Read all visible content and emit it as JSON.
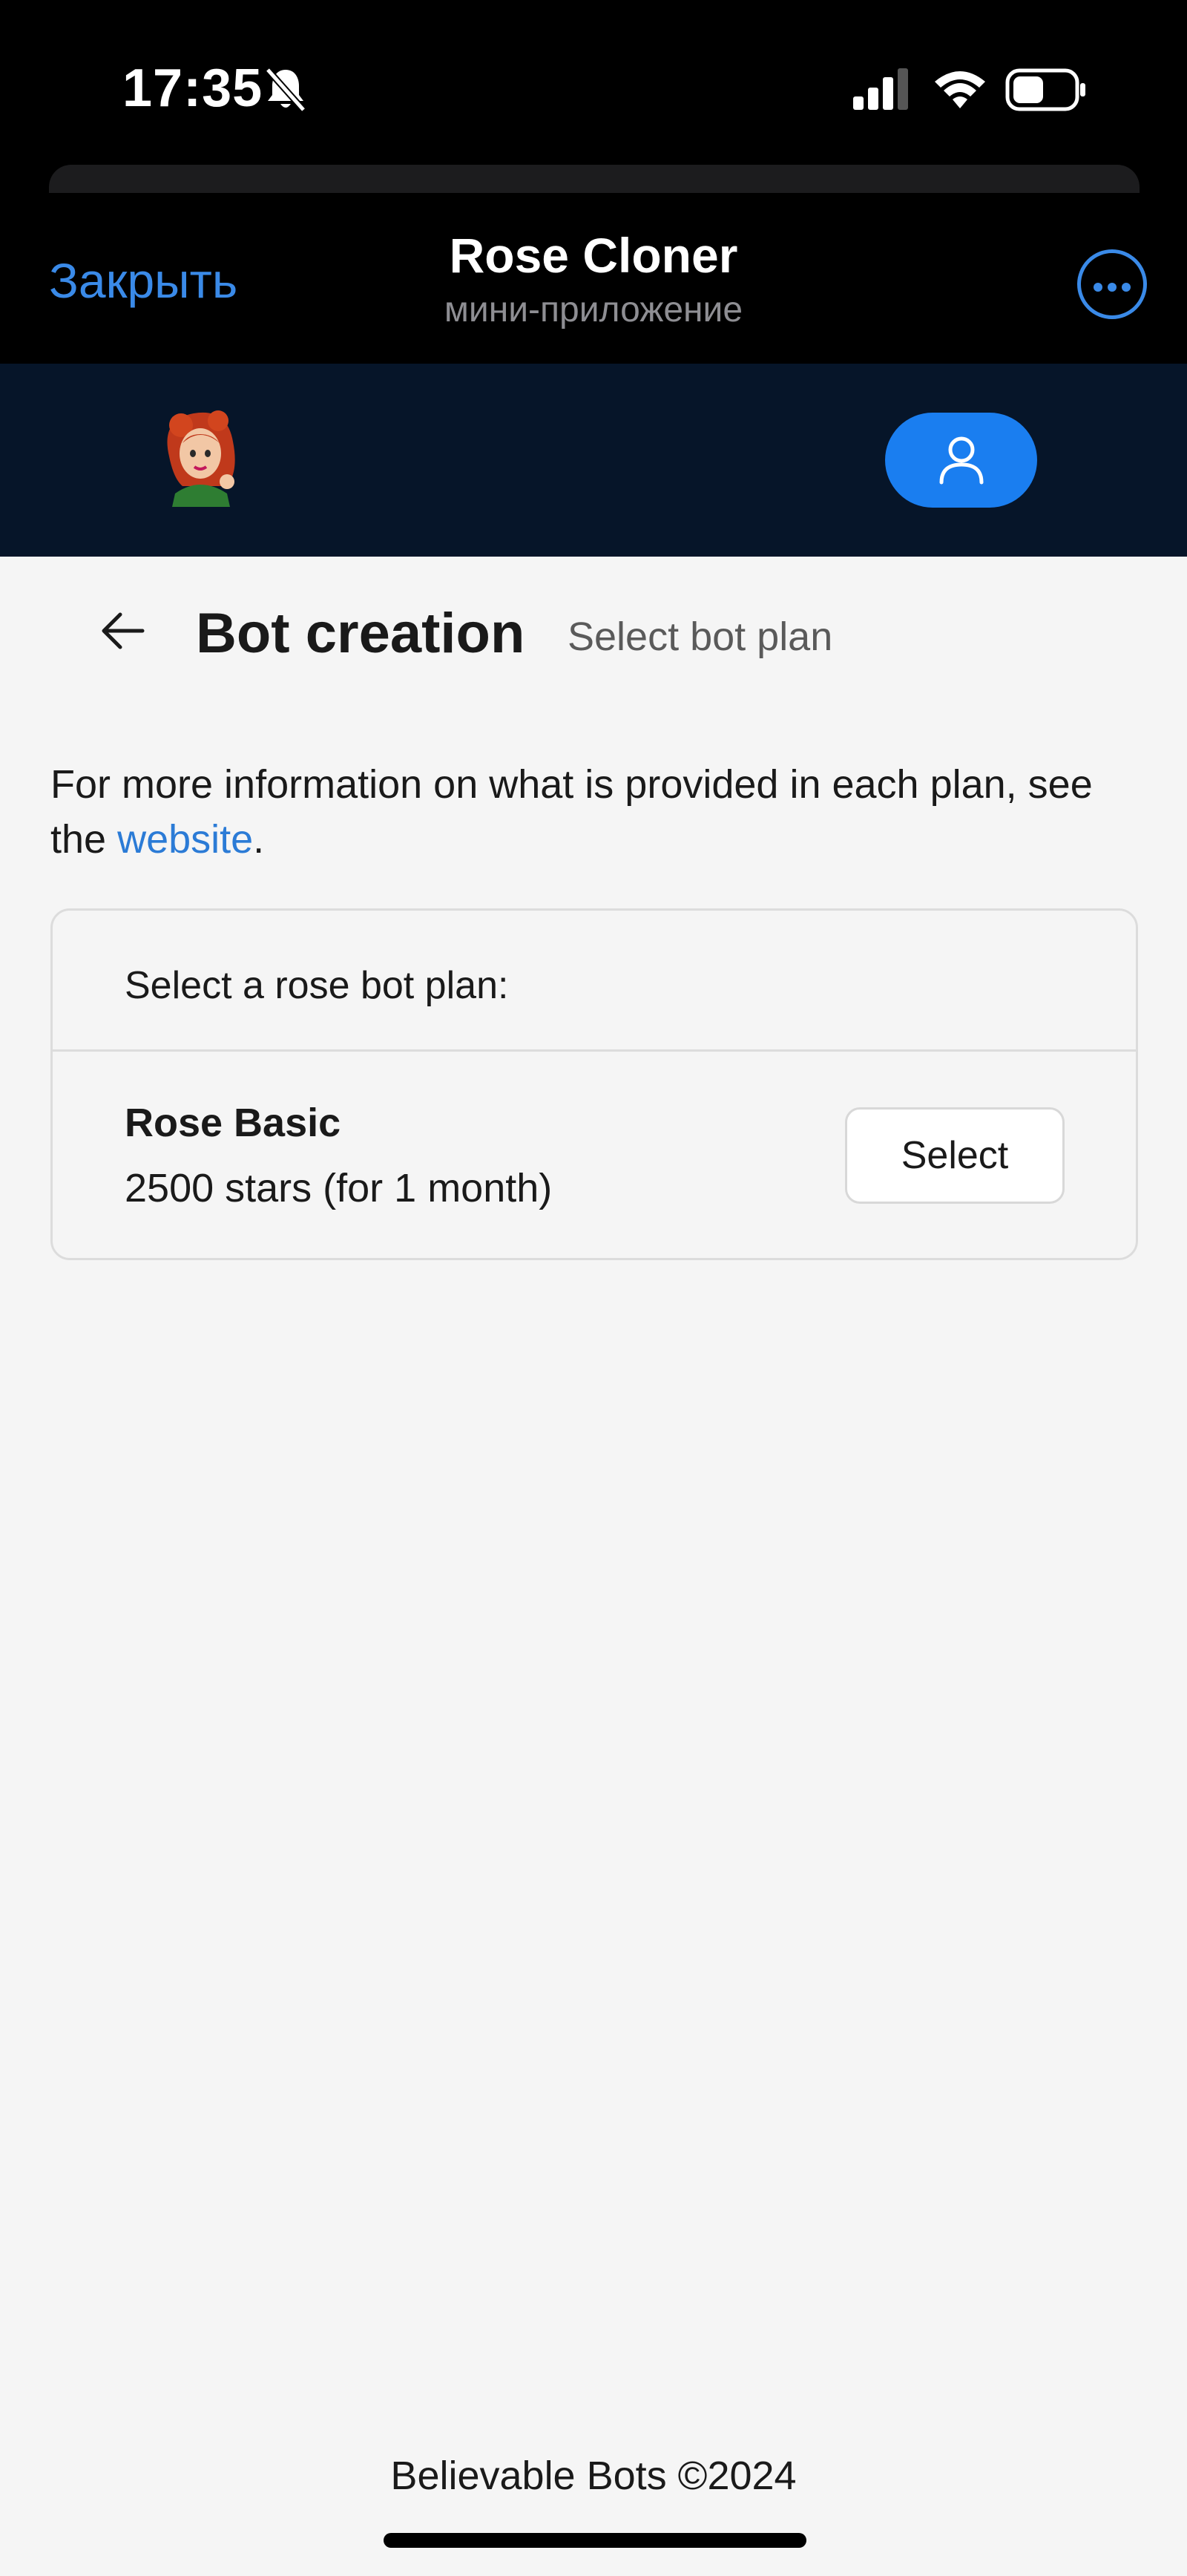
{
  "status_bar": {
    "time": "17:35",
    "icons": [
      "bell-slash-icon",
      "cellular-signal-icon",
      "wifi-icon",
      "battery-icon"
    ]
  },
  "telegram_header": {
    "close_label": "Закрыть",
    "title": "Rose Cloner",
    "subtitle": "мини-приложение",
    "more_icon": "more-horizontal-icon"
  },
  "app_header": {
    "logo": "rose-avatar-logo",
    "profile_icon": "user-icon"
  },
  "page": {
    "back_icon": "arrow-left-icon",
    "title": "Bot creation",
    "subtitle": "Select bot plan"
  },
  "info": {
    "text_before": "For more information on what is provided in each plan, see the ",
    "link_text": "website",
    "text_after": "."
  },
  "plans_card": {
    "header": "Select a rose bot plan:",
    "plans": [
      {
        "name": "Rose Basic",
        "price": "2500 stars (for 1 month)",
        "button_label": "Select"
      }
    ]
  },
  "footer": {
    "text": "Believable Bots ©2024"
  },
  "colors": {
    "accent": "#1a7ef0",
    "link": "#2b7bd6",
    "header_bg": "#061529",
    "content_bg": "#f5f5f5"
  }
}
